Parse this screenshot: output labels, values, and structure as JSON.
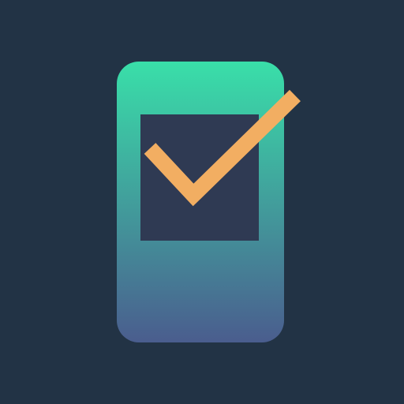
{
  "icon": {
    "name": "phone-checkmark-app-icon",
    "colors": {
      "background": "#223345",
      "phone_gradient_top": "#39DFA9",
      "phone_gradient_bottom": "#4A5D8E",
      "screen": "#2F3A53",
      "checkmark": "#F2AE62"
    }
  }
}
